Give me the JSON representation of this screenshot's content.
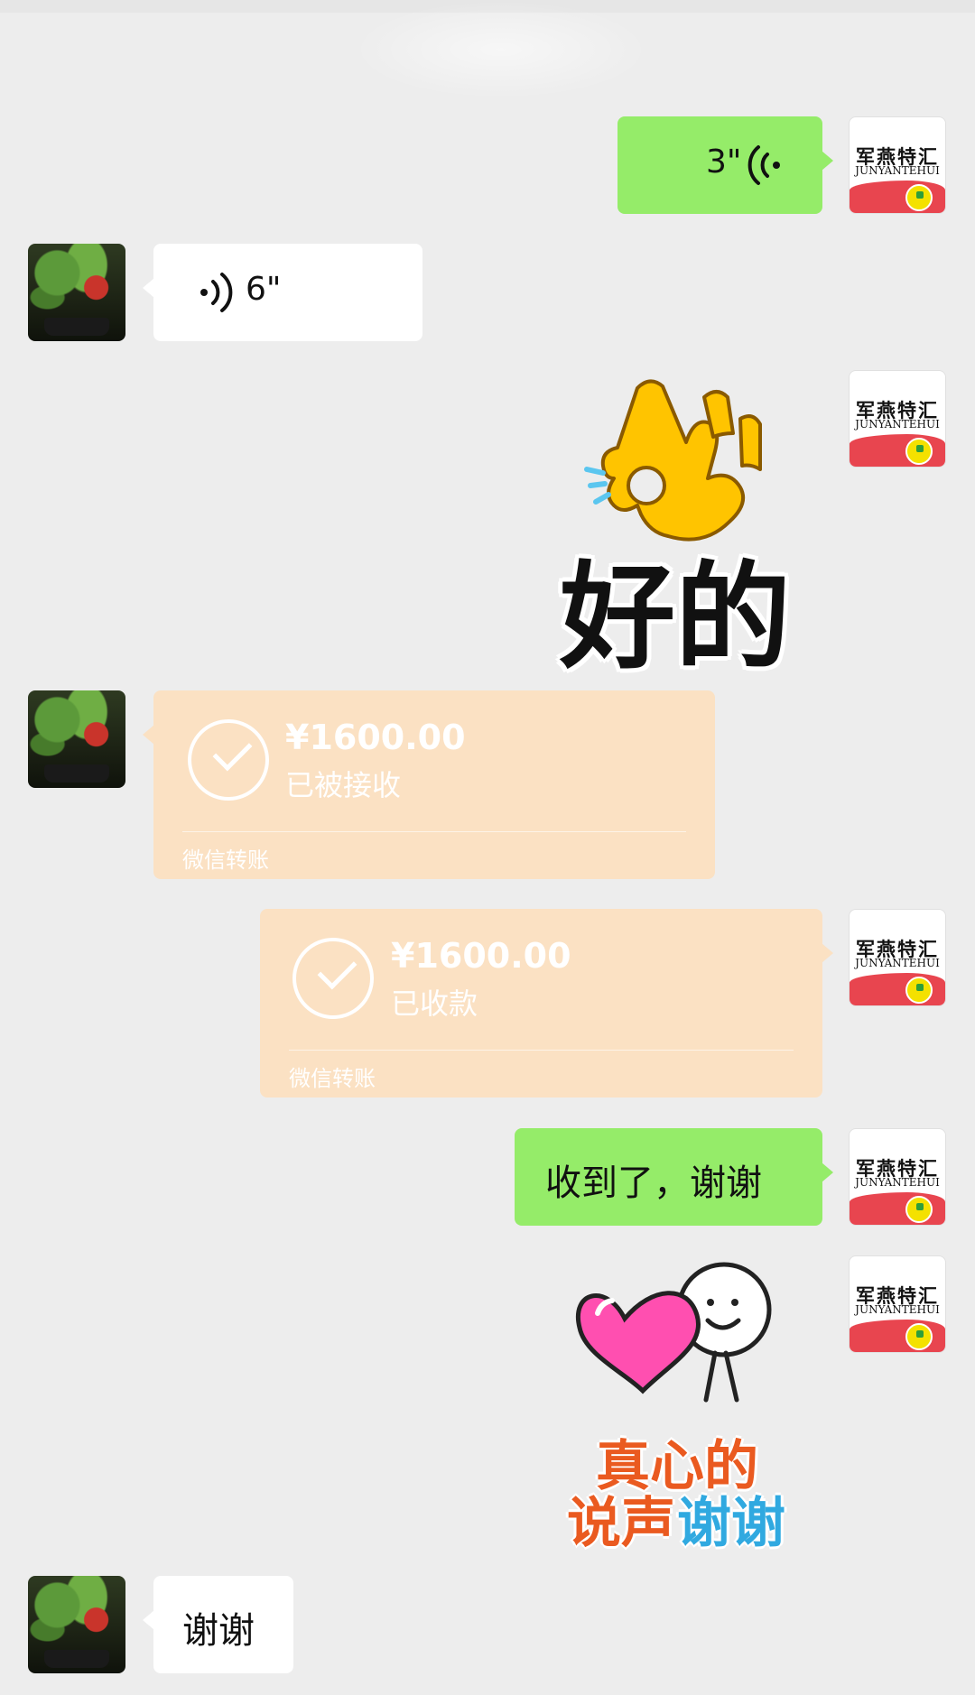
{
  "chat": {
    "messages": [
      {
        "id": "m1",
        "side": "me",
        "type": "voice",
        "duration": "3\""
      },
      {
        "id": "m2",
        "side": "peer",
        "type": "voice",
        "duration": "6\""
      },
      {
        "id": "m3",
        "side": "me",
        "type": "sticker",
        "sticker": "ok-hand-sticker",
        "text": "好的"
      },
      {
        "id": "m4",
        "side": "peer",
        "type": "transfer",
        "amount": "¥1600.00",
        "status": "已被接收",
        "label": "微信转账"
      },
      {
        "id": "m5",
        "side": "me",
        "type": "transfer",
        "amount": "¥1600.00",
        "status": "已收款",
        "label": "微信转账"
      },
      {
        "id": "m6",
        "side": "me",
        "type": "text",
        "text": "收到了，谢谢"
      },
      {
        "id": "m7",
        "side": "me",
        "type": "sticker",
        "sticker": "heart-thanks-sticker",
        "line1": "真心的",
        "line2a": "说声",
        "line2b": "谢谢"
      },
      {
        "id": "m8",
        "side": "peer",
        "type": "text",
        "text": "谢谢"
      }
    ]
  },
  "avatars": {
    "me": {
      "logo_text": "军燕特汇",
      "logo_sub": "JUNYANTEHUI",
      "icon": "brand-logo-avatar"
    },
    "peer": {
      "icon": "apple-tree-avatar"
    }
  },
  "colors": {
    "background": "#ededed",
    "me_bubble": "#95ec69",
    "peer_bubble": "#ffffff",
    "transfer_card": "#fbe1c3",
    "brand_red": "#e8454f",
    "thanks_orange": "#ea5a20",
    "thanks_blue": "#30a9e0"
  }
}
